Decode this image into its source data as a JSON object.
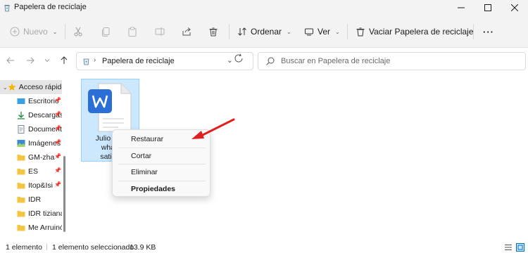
{
  "window": {
    "title": "Papelera de reciclaje"
  },
  "commandbar": {
    "new_label": "Nuevo",
    "sort_label": "Ordenar",
    "view_label": "Ver",
    "empty_label": "Vaciar Papelera de reciclaje",
    "more_label": "···"
  },
  "navbar": {
    "path": "Papelera de reciclaje",
    "search_placeholder": "Buscar en Papelera de reciclaje"
  },
  "sidebar": {
    "items": [
      {
        "label": "Acceso rápido",
        "icon": "star-icon"
      },
      {
        "label": "Escritorio",
        "icon": "desktop-icon"
      },
      {
        "label": "Descargas",
        "icon": "download-icon"
      },
      {
        "label": "Documentos",
        "icon": "document-icon"
      },
      {
        "label": "Imágenes",
        "icon": "image-icon"
      },
      {
        "label": "GM-zha",
        "icon": "folder-icon"
      },
      {
        "label": "ES",
        "icon": "folder-icon"
      },
      {
        "label": "Itop&Isi",
        "icon": "folder-icon"
      },
      {
        "label": "IDR",
        "icon": "folder-icon"
      },
      {
        "label": "IDR tiziana",
        "icon": "folder-icon"
      },
      {
        "label": "Me Arruinó",
        "icon": "folder-icon"
      }
    ]
  },
  "file": {
    "name_lines": [
      "Julio Hap",
      "what i",
      "satisfa"
    ],
    "icon": "word-document-icon"
  },
  "context_menu": {
    "items": [
      "Restaurar",
      "Cortar",
      "Eliminar",
      "Propiedades"
    ]
  },
  "statusbar": {
    "count": "1 elemento",
    "selected": "1 elemento seleccionado",
    "size": "13.9 KB"
  },
  "colors": {
    "accent": "#0067c0",
    "selection": "#cce8ff",
    "arrow": "#e02020",
    "folder": "#f3c542"
  }
}
